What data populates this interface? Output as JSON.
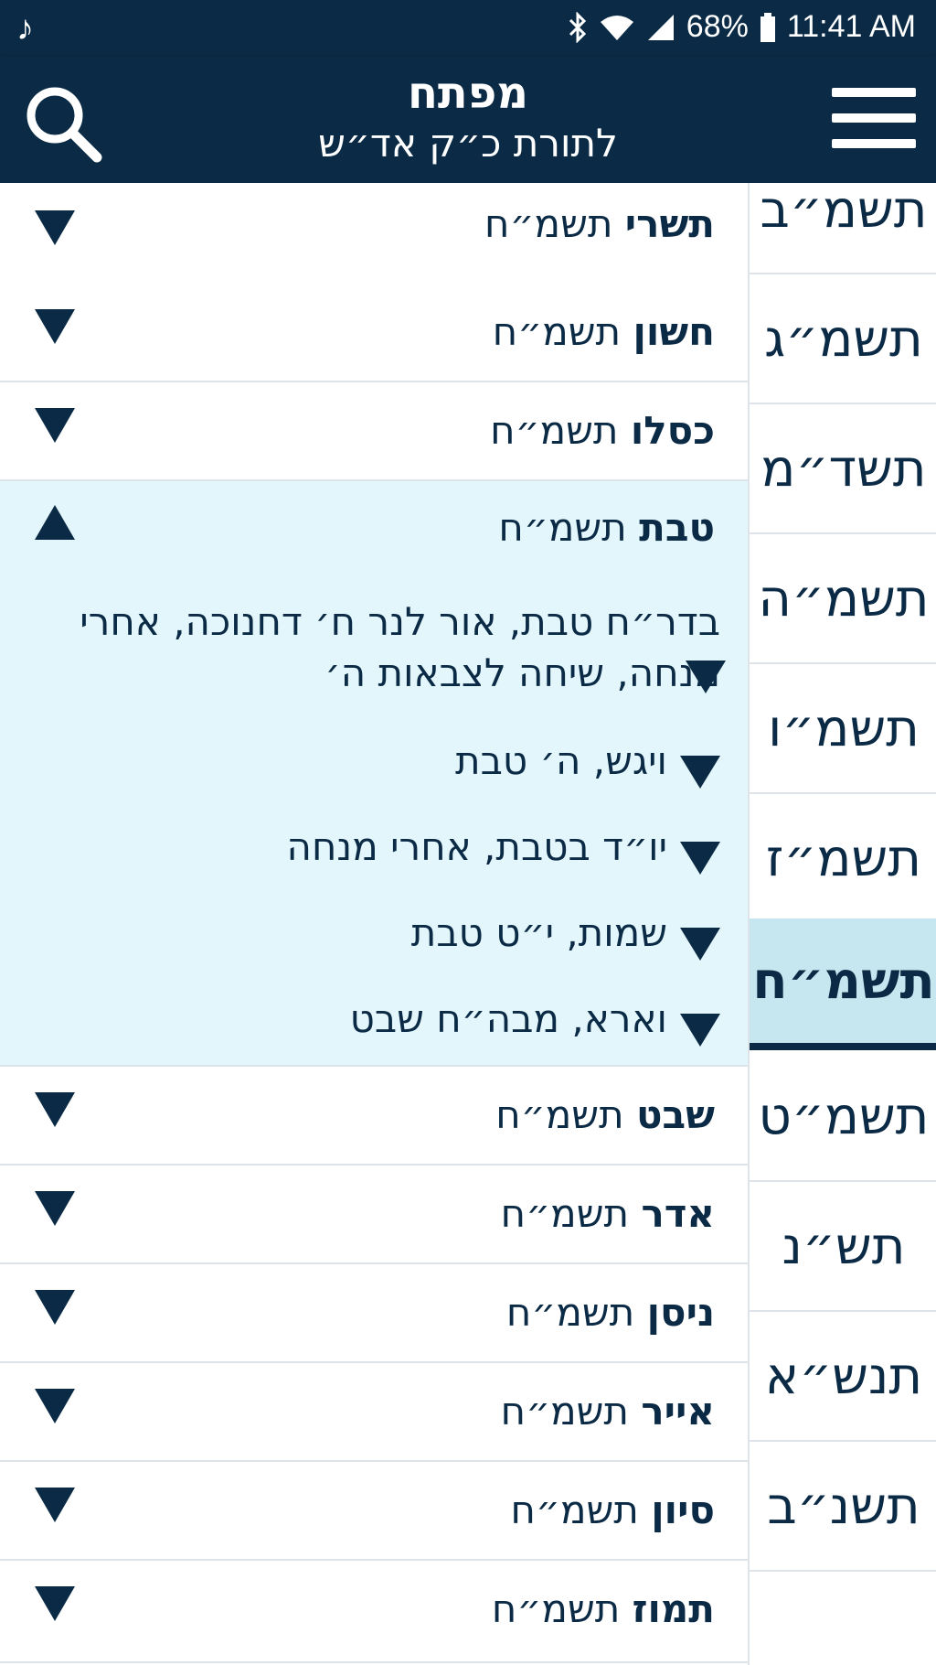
{
  "status_bar": {
    "music_icon": "♪",
    "battery": "68%",
    "time": "11:41 AM"
  },
  "header": {
    "title": "מפתח",
    "subtitle": "לתורת כ״ק אד״ש"
  },
  "colors": {
    "navy": "#0b2a45",
    "expanded_bg": "#e3f6fb",
    "active_year_bg": "#c6e6f0"
  },
  "months": [
    {
      "name": "תשרי",
      "year": "תשמ״ח"
    },
    {
      "name": "חשון",
      "year": "תשמ״ח"
    },
    {
      "name": "כסלו",
      "year": "תשמ״ח"
    },
    {
      "name": "טבת",
      "year": "תשמ״ח"
    },
    {
      "name": "שבט",
      "year": "תשמ״ח"
    },
    {
      "name": "אדר",
      "year": "תשמ״ח"
    },
    {
      "name": "ניסן",
      "year": "תשמ״ח"
    },
    {
      "name": "אייר",
      "year": "תשמ״ח"
    },
    {
      "name": "סיון",
      "year": "תשמ״ח"
    },
    {
      "name": "תמוז",
      "year": "תשמ״ח"
    }
  ],
  "expanded_items": [
    "בדר״ח טבת, אור לנר ח׳ דחנוכה, אחרי מנחה, שיחה לצבאות ה׳",
    "ויגש, ה׳ טבת",
    "יו״ד בטבת, אחרי מנחה",
    "שמות, י״ט טבת",
    "וארא, מבה״ח שבט"
  ],
  "years": [
    "תשמ״ב",
    "תשמ״ג",
    "תשד״מ",
    "תשמ״ה",
    "תשמ״ו",
    "תשמ״ז",
    "תשמ״ח",
    "תשמ״ט",
    "תש״נ",
    "תנש״א",
    "תשנ״ב"
  ],
  "active_year": "תשמ״ח"
}
